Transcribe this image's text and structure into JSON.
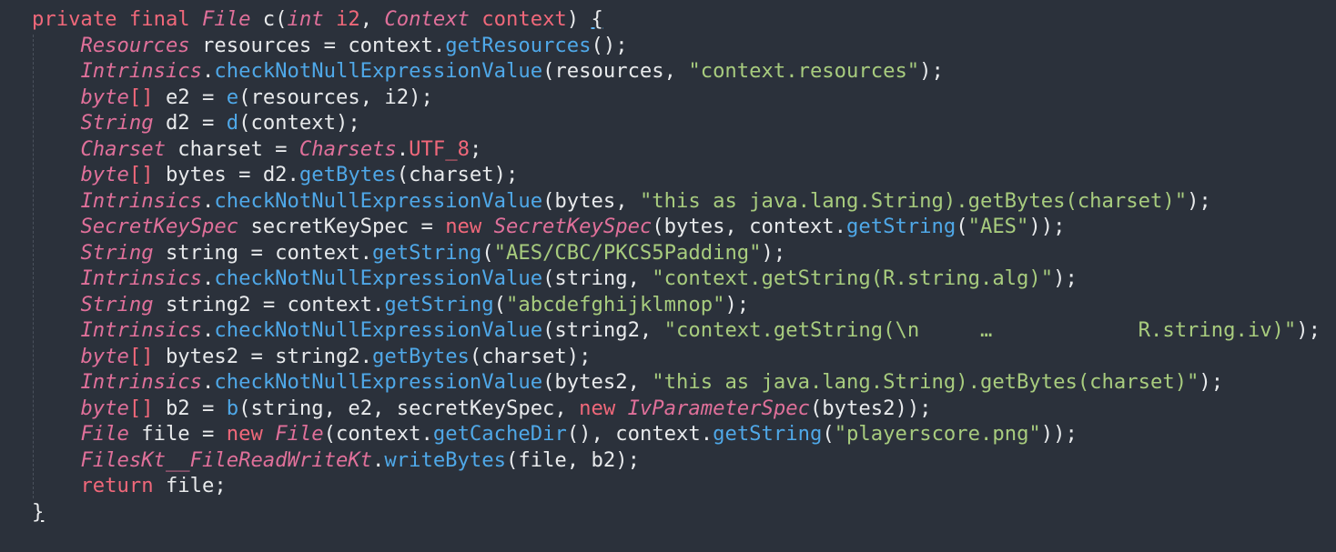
{
  "code_lines": [
    [
      {
        "c": "kw",
        "t": "private final "
      },
      {
        "c": "ty",
        "t": "File"
      },
      {
        "c": "pl",
        "t": " c("
      },
      {
        "c": "ty",
        "t": "int"
      },
      {
        "c": "pl",
        "t": " "
      },
      {
        "c": "kw",
        "t": "i2"
      },
      {
        "c": "pl",
        "t": ", "
      },
      {
        "c": "ty",
        "t": "Context"
      },
      {
        "c": "pl",
        "t": " "
      },
      {
        "c": "kw",
        "t": "context"
      },
      {
        "c": "pl",
        "t": ") "
      },
      {
        "c": "brace-open",
        "t": "{"
      }
    ],
    [
      {
        "c": "pl",
        "t": "    "
      },
      {
        "c": "ty",
        "t": "Resources"
      },
      {
        "c": "pl",
        "t": " resources = context."
      },
      {
        "c": "fn",
        "t": "getResources"
      },
      {
        "c": "pl",
        "t": "();"
      }
    ],
    [
      {
        "c": "pl",
        "t": "    "
      },
      {
        "c": "ty",
        "t": "Intrinsics"
      },
      {
        "c": "pl",
        "t": "."
      },
      {
        "c": "fn",
        "t": "checkNotNullExpressionValue"
      },
      {
        "c": "pl",
        "t": "(resources, "
      },
      {
        "c": "st",
        "t": "\"context.resources\""
      },
      {
        "c": "pl",
        "t": ");"
      }
    ],
    [
      {
        "c": "pl",
        "t": "    "
      },
      {
        "c": "ty",
        "t": "byte"
      },
      {
        "c": "kw",
        "t": "[]"
      },
      {
        "c": "pl",
        "t": " e2 = "
      },
      {
        "c": "fn",
        "t": "e"
      },
      {
        "c": "pl",
        "t": "(resources, i2);"
      }
    ],
    [
      {
        "c": "pl",
        "t": "    "
      },
      {
        "c": "ty",
        "t": "String"
      },
      {
        "c": "pl",
        "t": " d2 = "
      },
      {
        "c": "fn",
        "t": "d"
      },
      {
        "c": "pl",
        "t": "(context);"
      }
    ],
    [
      {
        "c": "pl",
        "t": "    "
      },
      {
        "c": "ty",
        "t": "Charset"
      },
      {
        "c": "pl",
        "t": " charset = "
      },
      {
        "c": "ty",
        "t": "Charsets"
      },
      {
        "c": "pl",
        "t": "."
      },
      {
        "c": "kw",
        "t": "UTF_8"
      },
      {
        "c": "pl",
        "t": ";"
      }
    ],
    [
      {
        "c": "pl",
        "t": "    "
      },
      {
        "c": "ty",
        "t": "byte"
      },
      {
        "c": "kw",
        "t": "[]"
      },
      {
        "c": "pl",
        "t": " bytes = d2."
      },
      {
        "c": "fn",
        "t": "getBytes"
      },
      {
        "c": "pl",
        "t": "(charset);"
      }
    ],
    [
      {
        "c": "pl",
        "t": "    "
      },
      {
        "c": "ty",
        "t": "Intrinsics"
      },
      {
        "c": "pl",
        "t": "."
      },
      {
        "c": "fn",
        "t": "checkNotNullExpressionValue"
      },
      {
        "c": "pl",
        "t": "(bytes, "
      },
      {
        "c": "st",
        "t": "\"this as java.lang.String).getBytes(charset)\""
      },
      {
        "c": "pl",
        "t": ");"
      }
    ],
    [
      {
        "c": "pl",
        "t": "    "
      },
      {
        "c": "ty",
        "t": "SecretKeySpec"
      },
      {
        "c": "pl",
        "t": " secretKeySpec = "
      },
      {
        "c": "kw",
        "t": "new "
      },
      {
        "c": "ty",
        "t": "SecretKeySpec"
      },
      {
        "c": "pl",
        "t": "(bytes, context."
      },
      {
        "c": "fn",
        "t": "getString"
      },
      {
        "c": "pl",
        "t": "("
      },
      {
        "c": "st",
        "t": "\"AES\""
      },
      {
        "c": "pl",
        "t": "));"
      }
    ],
    [
      {
        "c": "pl",
        "t": "    "
      },
      {
        "c": "ty",
        "t": "String"
      },
      {
        "c": "pl",
        "t": " string = context."
      },
      {
        "c": "fn",
        "t": "getString"
      },
      {
        "c": "pl",
        "t": "("
      },
      {
        "c": "st",
        "t": "\"AES/CBC/PKCS5Padding\""
      },
      {
        "c": "pl",
        "t": ");"
      }
    ],
    [
      {
        "c": "pl",
        "t": "    "
      },
      {
        "c": "ty",
        "t": "Intrinsics"
      },
      {
        "c": "pl",
        "t": "."
      },
      {
        "c": "fn",
        "t": "checkNotNullExpressionValue"
      },
      {
        "c": "pl",
        "t": "(string, "
      },
      {
        "c": "st",
        "t": "\"context.getString(R.string.alg)\""
      },
      {
        "c": "pl",
        "t": ");"
      }
    ],
    [
      {
        "c": "pl",
        "t": "    "
      },
      {
        "c": "ty",
        "t": "String"
      },
      {
        "c": "pl",
        "t": " string2 = context."
      },
      {
        "c": "fn",
        "t": "getString"
      },
      {
        "c": "pl",
        "t": "("
      },
      {
        "c": "st",
        "t": "\"abcdefghijklmnop\""
      },
      {
        "c": "pl",
        "t": ");"
      }
    ],
    [
      {
        "c": "pl",
        "t": "    "
      },
      {
        "c": "ty",
        "t": "Intrinsics"
      },
      {
        "c": "pl",
        "t": "."
      },
      {
        "c": "fn",
        "t": "checkNotNullExpressionValue"
      },
      {
        "c": "pl",
        "t": "(string2, "
      },
      {
        "c": "st",
        "t": "\"context.getString(\\n     …            R.string.iv)\""
      },
      {
        "c": "pl",
        "t": ");"
      }
    ],
    [
      {
        "c": "pl",
        "t": "    "
      },
      {
        "c": "ty",
        "t": "byte"
      },
      {
        "c": "kw",
        "t": "[]"
      },
      {
        "c": "pl",
        "t": " bytes2 = string2."
      },
      {
        "c": "fn",
        "t": "getBytes"
      },
      {
        "c": "pl",
        "t": "(charset);"
      }
    ],
    [
      {
        "c": "pl",
        "t": "    "
      },
      {
        "c": "ty",
        "t": "Intrinsics"
      },
      {
        "c": "pl",
        "t": "."
      },
      {
        "c": "fn",
        "t": "checkNotNullExpressionValue"
      },
      {
        "c": "pl",
        "t": "(bytes2, "
      },
      {
        "c": "st",
        "t": "\"this as java.lang.String).getBytes(charset)\""
      },
      {
        "c": "pl",
        "t": ");"
      }
    ],
    [
      {
        "c": "pl",
        "t": "    "
      },
      {
        "c": "ty",
        "t": "byte"
      },
      {
        "c": "kw",
        "t": "[]"
      },
      {
        "c": "pl",
        "t": " b2 = "
      },
      {
        "c": "fn",
        "t": "b"
      },
      {
        "c": "pl",
        "t": "(string, e2, secretKeySpec, "
      },
      {
        "c": "kw",
        "t": "new "
      },
      {
        "c": "ty",
        "t": "IvParameterSpec"
      },
      {
        "c": "pl",
        "t": "(bytes2));"
      }
    ],
    [
      {
        "c": "pl",
        "t": "    "
      },
      {
        "c": "ty",
        "t": "File"
      },
      {
        "c": "pl",
        "t": " file = "
      },
      {
        "c": "kw",
        "t": "new "
      },
      {
        "c": "ty",
        "t": "File"
      },
      {
        "c": "pl",
        "t": "(context."
      },
      {
        "c": "fn",
        "t": "getCacheDir"
      },
      {
        "c": "pl",
        "t": "(), context."
      },
      {
        "c": "fn",
        "t": "getString"
      },
      {
        "c": "pl",
        "t": "("
      },
      {
        "c": "st",
        "t": "\"playerscore.png\""
      },
      {
        "c": "pl",
        "t": "));"
      }
    ],
    [
      {
        "c": "pl",
        "t": "    "
      },
      {
        "c": "ty",
        "t": "FilesKt__FileReadWriteKt"
      },
      {
        "c": "pl",
        "t": "."
      },
      {
        "c": "fn",
        "t": "writeBytes"
      },
      {
        "c": "pl",
        "t": "(file, b2);"
      }
    ],
    [
      {
        "c": "pl",
        "t": "    "
      },
      {
        "c": "kw",
        "t": "return"
      },
      {
        "c": "pl",
        "t": " file;"
      }
    ],
    [
      {
        "c": "brace-close",
        "t": "}"
      }
    ]
  ],
  "colors": {
    "background": "#2b313b",
    "keyword": "#f0687a",
    "type": "#e0709a",
    "function": "#4fa8e8",
    "string": "#a8cc7e",
    "plain": "#e8eaec"
  }
}
